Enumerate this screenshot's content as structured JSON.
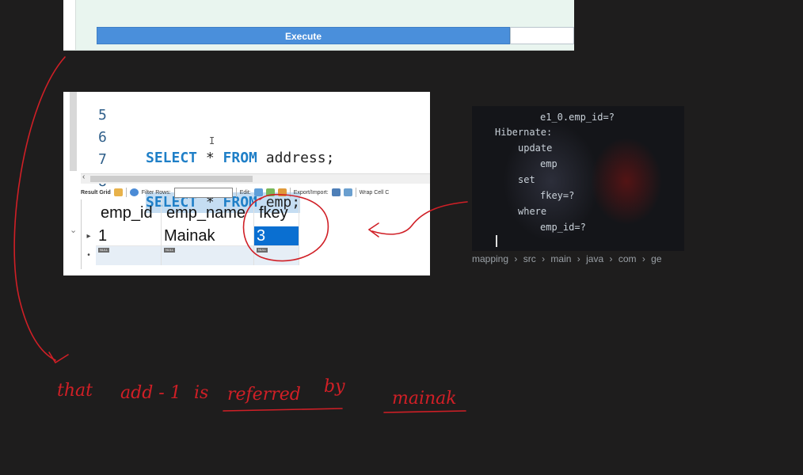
{
  "execute_panel": {
    "button_label": "Execute"
  },
  "editor": {
    "lines": [
      {
        "num": "5",
        "text": ""
      },
      {
        "num": "6",
        "kw1": "SELECT",
        "mid": " * ",
        "kw2": "FROM",
        "rest": " address;"
      },
      {
        "num": "7",
        "text": ""
      },
      {
        "num": "8",
        "marker": "•",
        "kw1": "SELECT",
        "mid": " * ",
        "kw2": "FROM",
        "rest": " emp;"
      }
    ],
    "cursor_glyph": "I"
  },
  "toolbar": {
    "result_grid": "Result Grid",
    "filter_rows": "Filter Rows:",
    "edit": "Edit:",
    "export_import": "Export/Import:",
    "wrap_cell": "Wrap Cell C"
  },
  "result_grid": {
    "columns": [
      "emp_id",
      "emp_name",
      "fkey"
    ],
    "row": [
      "1",
      "Mainak",
      "3"
    ],
    "null_label": "NULL",
    "row_marker": "▸",
    "new_row_marker": "•",
    "collapse_marker": "⌄"
  },
  "terminal": {
    "lines": [
      "e1_0.emp_id=?",
      "Hibernate:",
      "update",
      "emp",
      "set",
      "fkey=?",
      "where",
      "emp_id=?"
    ]
  },
  "breadcrumb": [
    "mapping",
    "›",
    "src",
    "›",
    "main",
    "›",
    "java",
    "›",
    "com",
    "›",
    "ge"
  ],
  "annotation": {
    "text_parts": [
      "that",
      "add - 1",
      "is",
      "referred",
      "by",
      "mainak"
    ],
    "ink_color": "#d01f26"
  }
}
